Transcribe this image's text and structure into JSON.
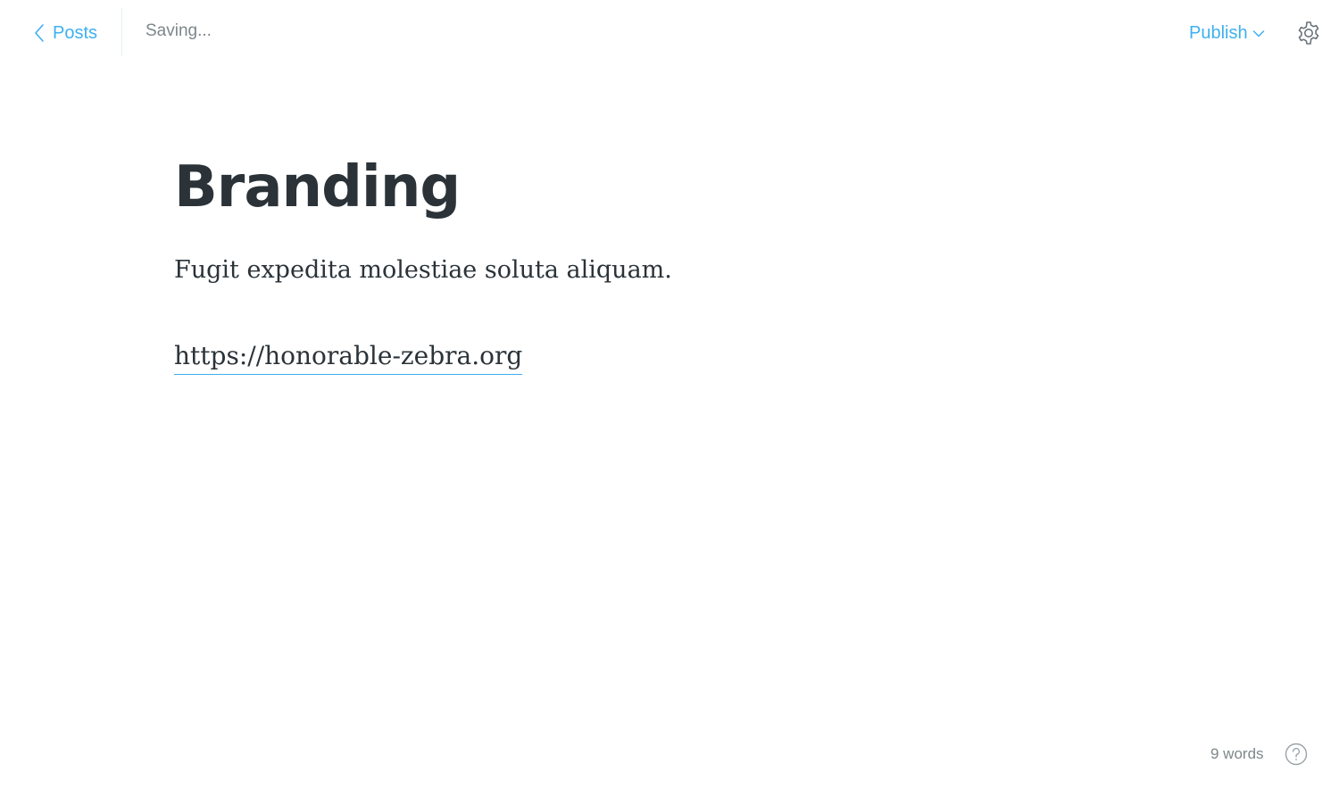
{
  "header": {
    "back_label": "Posts",
    "save_status": "Saving...",
    "publish_label": "Publish"
  },
  "post": {
    "title": "Branding",
    "paragraph": "Fugit expedita molestiae soluta aliquam.",
    "link": "https://honorable-zebra.org"
  },
  "footer": {
    "word_count": "9 words"
  },
  "icons": {
    "back": "chevron-left-icon",
    "publish_dropdown": "chevron-down-icon",
    "settings": "gear-icon",
    "help": "question-circle-icon"
  },
  "colors": {
    "accent": "#3eb0ef",
    "text": "#2b3339",
    "muted": "#7d878a",
    "divider": "#e5eff5",
    "link_underline": "#3eb0ef"
  }
}
